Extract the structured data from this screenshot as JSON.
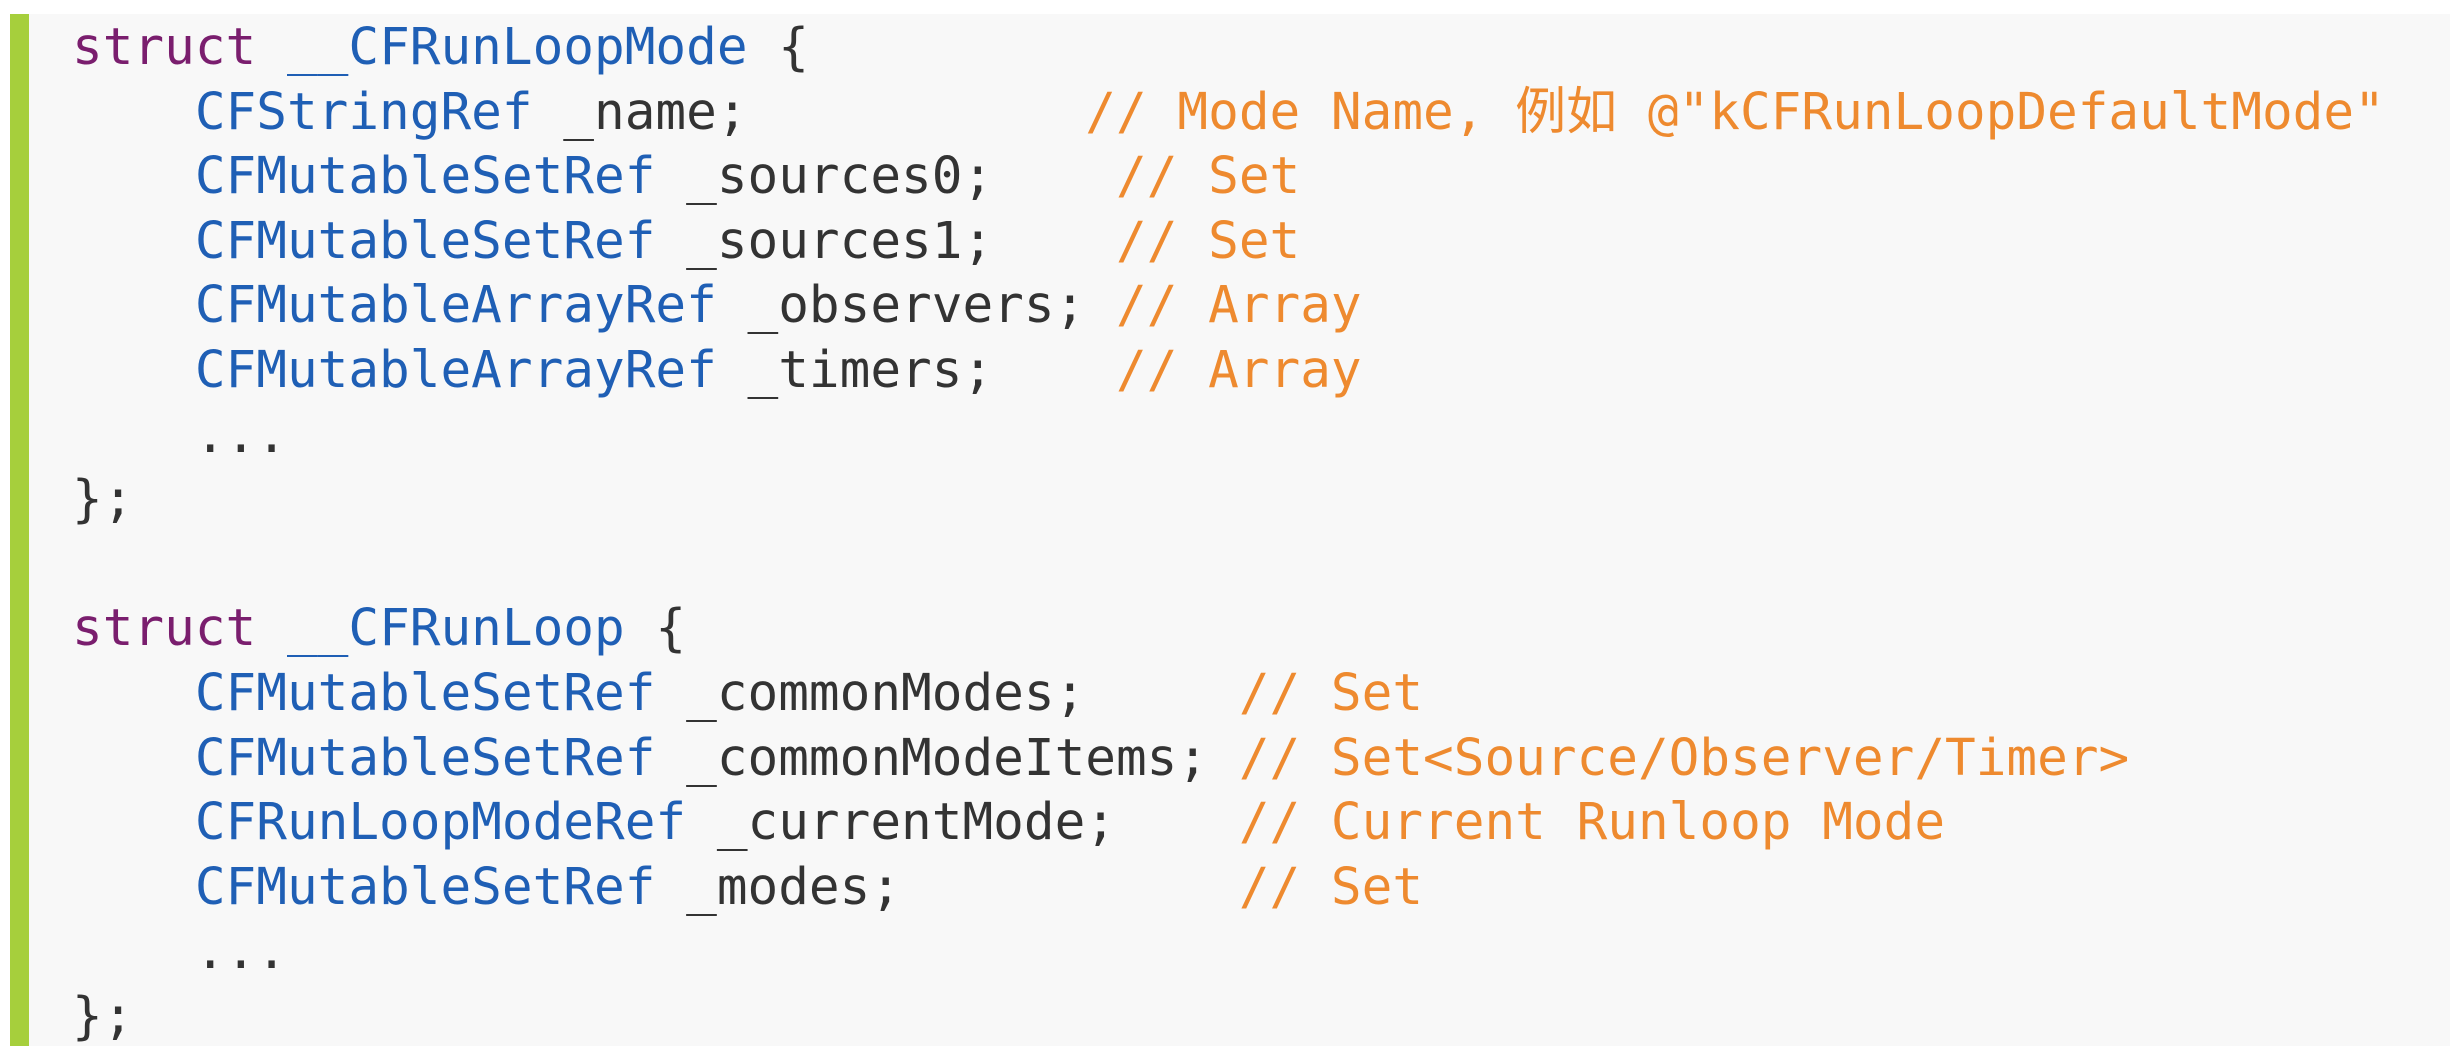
{
  "accent_color": "#a6cf3c",
  "colors": {
    "keyword": "#7a1e6e",
    "type": "#1f5fb5",
    "plain": "#333333",
    "comment": "#ee8a2f",
    "background": "#f8f8f8"
  },
  "code": {
    "struct1": {
      "keyword": "struct",
      "name": "__CFRunLoopMode",
      "open": " {",
      "close": "};",
      "ellipsis": "...",
      "fields": [
        {
          "type": "CFStringRef",
          "name": " _name;",
          "pad": "           ",
          "comment": "// Mode Name, 例如 @\"kCFRunLoopDefaultMode\""
        },
        {
          "type": "CFMutableSetRef",
          "name": " _sources0;",
          "pad": "    ",
          "comment": "// Set"
        },
        {
          "type": "CFMutableSetRef",
          "name": " _sources1;",
          "pad": "    ",
          "comment": "// Set"
        },
        {
          "type": "CFMutableArrayRef",
          "name": " _observers;",
          "pad": " ",
          "comment": "// Array"
        },
        {
          "type": "CFMutableArrayRef",
          "name": " _timers;",
          "pad": "    ",
          "comment": "// Array"
        }
      ]
    },
    "struct2": {
      "keyword": "struct",
      "name": "__CFRunLoop",
      "open": " {",
      "close": "};",
      "ellipsis": "...",
      "fields": [
        {
          "type": "CFMutableSetRef",
          "name": " _commonModes;",
          "pad": "     ",
          "comment": "// Set"
        },
        {
          "type": "CFMutableSetRef",
          "name": " _commonModeItems;",
          "pad": " ",
          "comment": "// Set<Source/Observer/Timer>"
        },
        {
          "type": "CFRunLoopModeRef",
          "name": " _currentMode;",
          "pad": "    ",
          "comment": "// Current Runloop Mode"
        },
        {
          "type": "CFMutableSetRef",
          "name": " _modes;",
          "pad": "           ",
          "comment": "// Set"
        }
      ]
    }
  }
}
